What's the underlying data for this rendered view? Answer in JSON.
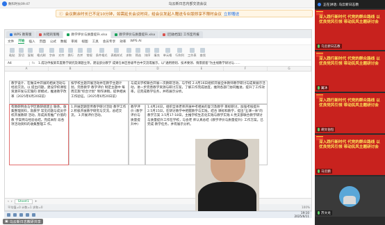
{
  "meeting": {
    "app_title": "数科时长09:47",
    "center_title": "乌云新日志内部交流会议",
    "notice_text": "会议剩余时长已不足10分钟，如需延长会议时间，给会议发起人赠送专业版即享不限时会议",
    "notice_link": "立即赠送"
  },
  "screen": {
    "tabs": [
      {
        "label": "WPS 教育版",
        "mark": "b"
      },
      {
        "label": "纠错的策略",
        "mark": ""
      },
      {
        "label": "教学评价与质量提升.xlsx",
        "mark": "g"
      },
      {
        "label": "教学评价与质量提升.xlsx",
        "mark": "g"
      },
      {
        "label": "[回收档案] 工作室月报",
        "mark": ""
      }
    ],
    "menu": [
      "文件",
      "开始",
      "插入",
      "页面",
      "公式",
      "数据",
      "审阅",
      "视图",
      "工具",
      "会员专享",
      "效率",
      "WPS AI"
    ],
    "menu_active": "开始",
    "ribbon": [
      "粘贴",
      "剪切",
      "复制",
      "格式刷",
      "字体",
      "对齐",
      "换行",
      "合并",
      "常规",
      "条件格式",
      "表格样式",
      "求和",
      "筛选",
      "排序",
      "填充",
      "单元格",
      "行和列",
      "工作表",
      "查找"
    ],
    "formula": {
      "cell_ref": "A4",
      "fx": "fx",
      "content": "1.成功申报某年度教学研究及课题立项，建设部分教学 成果在本区各级平台中交流或展示，以\"通用原则、技术要领、情景嵌套\"为主线教学研讨与……"
    },
    "columns": [
      "A",
      "B",
      "C",
      "D",
      "E",
      "F",
      "G"
    ],
    "cells": {
      "c1": "教学设计、在做法中开展的相关活动与经验交流，以 提出问题，建设学校课程资源开发与实施的 新模式，推进教学改革（2025年6月20日前）",
      "c2": "按学校主题开展活动并在教学主题计划，完善教学 教学评价 制定主题中 每周实施\"综合计划\" 制作讲稿，提供相关工作验证。（2025年6月20日前）",
      "c3": "与成员学校联合开展一次教研活动，与学校 2.4月16日组织开展全体教师教学研讨与成果展示活动，进一步完善教学资源与研讨方案，了解工作完成进度，维持各部门协同推进，提升了工作效率。已完成教学任务，并有展示分析。",
      "c4": "有教研例会与学区教研组建立 联系，收集整理资料，就教学 常见问题与成员学校开展教研 活动，形成具有推广价值的教 学案例与经验总结。完成本阶 段各项活动资料的收集整理工 作。",
      "c5": "1.开展定期宣传教学研讨活动 教学工作 2.积极开展教学研究与交流，总结交流。 3.开展评价活动。",
      "c6": "教学评价 (教学评价与质量提升中)",
      "c7": "1.4月24日，组织全体老师开展中考相关的复习及教学 目标研讨，加强考核提升 2.5月15日，在研讨教学中把握教学与实践，结合 课标和教学，提出\"五课一体\"的教学方案 3.5月17-18日，主推学校生态化实践与教学实践 4.党支部联合教学研讨与质量提升工作在学校，与会老 师认真总结《教学评价与质量提升》工作方案。已完成 教学任务，并有展示分析。"
    },
    "sheet_tab": "Sheet1",
    "status_left": "平均值=0 计数=1 求和=0",
    "status_right": "100%",
    "taskbar_time": "19:10",
    "taskbar_date": "2025/6/11"
  },
  "presenter": {
    "label": "乌云新日志教研共享"
  },
  "panel": {
    "header": "正在讲话: 乌云新日志教",
    "banner_text": "深入践行新时代 代党的群众路线 以优良党风引领 带动民风主题研讨会",
    "participants": [
      {
        "name": "乌云新日志教",
        "type": "banner"
      },
      {
        "name": "翼沐",
        "type": "banner"
      },
      {
        "name": "胡文伯恒",
        "type": "banner"
      },
      {
        "name": "马云鹏",
        "type": "banner"
      },
      {
        "name": "苏文龙",
        "type": "avatar"
      }
    ]
  },
  "colors": {
    "accent": "#1aa35b",
    "banner_red": "#c8221e",
    "banner_text": "#ffe65a",
    "notice_text": "#b85c00"
  }
}
